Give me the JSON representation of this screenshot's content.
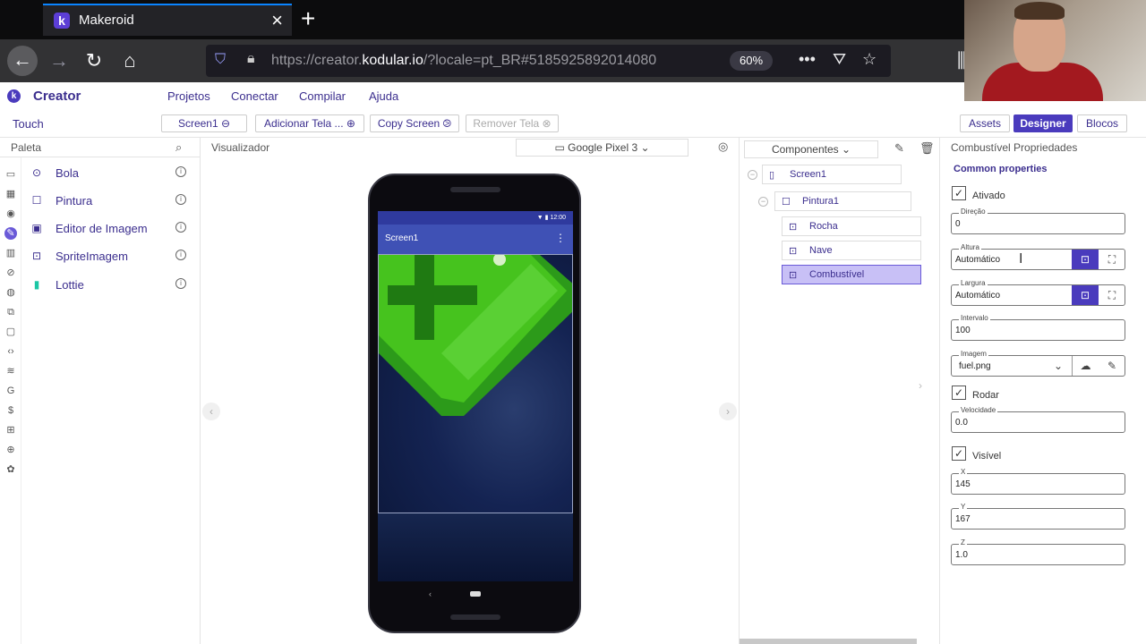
{
  "browser": {
    "tab_title": "Makeroid",
    "tab_favicon": "k",
    "url_prefix": "https://creator.",
    "url_domain": "kodular.io",
    "url_suffix": "/?locale=pt_BR#5185925892014080",
    "zoom": "60%"
  },
  "app": {
    "brand": "Creator",
    "menu": [
      "Projetos",
      "Conectar",
      "Compilar",
      "Ajuda"
    ]
  },
  "toolbar": {
    "project": "Touch",
    "screen_btn": "Screen1 ⊖",
    "add_screen": "Adicionar Tela ... ⊕",
    "copy_screen": "Copy Screen ⧁",
    "remove_screen": "Remover Tela ⊗",
    "assets": "Assets",
    "designer": "Designer",
    "blocks": "Blocos"
  },
  "palette": {
    "title": "Paleta",
    "items": [
      {
        "label": "Bola",
        "icon": "⊙"
      },
      {
        "label": "Pintura",
        "icon": "☐"
      },
      {
        "label": "Editor de Imagem",
        "icon": "▣"
      },
      {
        "label": "SpriteImagem",
        "icon": "⊡"
      },
      {
        "label": "Lottie",
        "icon": "▮"
      }
    ]
  },
  "viewer": {
    "title": "Visualizador",
    "device": "Google Pixel 3",
    "status_time": "12:00",
    "screen_title": "Screen1"
  },
  "components": {
    "title": "Componentes",
    "tree": [
      {
        "label": "Screen1",
        "icon": "▯"
      },
      {
        "label": "Pintura1",
        "icon": "☐"
      },
      {
        "label": "Rocha",
        "icon": "⊡"
      },
      {
        "label": "Nave",
        "icon": "⊡"
      },
      {
        "label": "Combustível",
        "icon": "⊡"
      }
    ]
  },
  "properties": {
    "title": "Combustível Propriedades",
    "section": "Common properties",
    "ativado_label": "Ativado",
    "direcao_label": "Direção",
    "direcao_value": "0",
    "altura_label": "Altura",
    "altura_value": "Automático",
    "largura_label": "Largura",
    "largura_value": "Automático",
    "intervalo_label": "Intervalo",
    "intervalo_value": "100",
    "imagem_label": "Imagem",
    "imagem_value": "fuel.png",
    "rodar_label": "Rodar",
    "velocidade_label": "Velocidade",
    "velocidade_value": "0.0",
    "visivel_label": "Visível",
    "x_label": "X",
    "x_value": "145",
    "y_label": "Y",
    "y_value": "167",
    "z_label": "Z",
    "z_value": "1.0"
  },
  "colors": {
    "accent": "#4a3bbd",
    "selected": "#c8c0f6",
    "appbar": "#3f51b5",
    "fuel_green": "#3fbf1f"
  }
}
